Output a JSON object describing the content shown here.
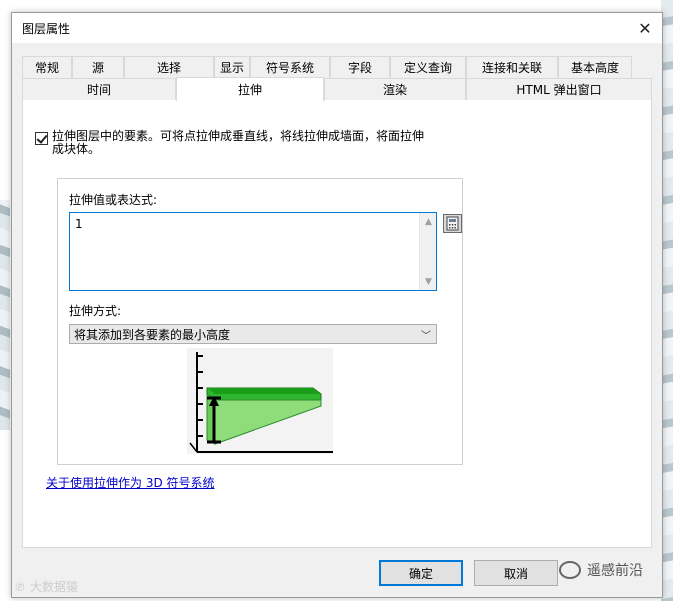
{
  "window": {
    "title": "图层属性"
  },
  "tabs": {
    "row_top": [
      "常规",
      "源",
      "选择",
      "显示",
      "符号系统",
      "字段",
      "定义查询",
      "连接和关联",
      "基本高度"
    ],
    "row_bottom": [
      "时间",
      "拉伸",
      "渲染",
      "HTML 弹出窗口"
    ],
    "active": "拉伸"
  },
  "extrusion": {
    "checkbox_label_line1": "拉伸图层中的要素。可将点拉伸成垂直线，将线拉伸成墙面，将面拉伸",
    "checkbox_label_line2": "成块体。",
    "checked": true,
    "expression_label": "拉伸值或表达式:",
    "expression_value": "1",
    "method_label": "拉伸方式:",
    "method_selected": "将其添加到各要素的最小高度",
    "help_link": "关于使用拉伸作为 3D 符号系统"
  },
  "buttons": {
    "ok": "确定",
    "cancel": "取消"
  },
  "watermarks": {
    "left": "大数据猿",
    "right": "遥感前沿"
  },
  "colors": {
    "accent": "#0078d7",
    "diagram_green": "#1a9e1a",
    "diagram_light_green": "#8edc7a",
    "link": "#0000cc"
  }
}
